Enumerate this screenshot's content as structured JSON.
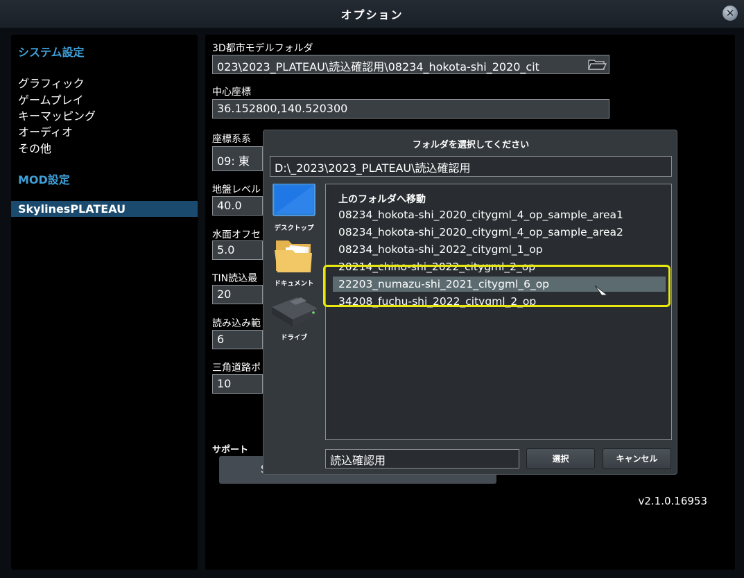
{
  "window": {
    "title": "オプション",
    "close_icon": "close-icon"
  },
  "sidebar": {
    "system_heading": "システム設定",
    "items": [
      "グラフィック",
      "ゲームプレイ",
      "キーマッピング",
      "オーディオ",
      "その他"
    ],
    "mod_heading": "MOD設定",
    "mod_items": [
      "SkylinesPLATEAU"
    ]
  },
  "main": {
    "fields": [
      {
        "label": "3D都市モデルフォルダ",
        "value": "023\\2023_PLATEAU\\読込確認用\\08234_hokota-shi_2020_cit"
      },
      {
        "label": "中心座標",
        "value": "36.152800,140.520300"
      },
      {
        "label": "座標系系",
        "value": "09: 東"
      },
      {
        "label": "地盤レベル",
        "value": "40.0"
      },
      {
        "label": "水面オフセ",
        "value": "5.0"
      },
      {
        "label": "TIN読込最",
        "value": "20"
      },
      {
        "label": "読み込み範",
        "value": "6"
      },
      {
        "label": "三角道路ポ",
        "value": "10"
      }
    ],
    "support_label": "サポート",
    "support_button": "S",
    "version": "v2.1.0.16953"
  },
  "dialog": {
    "title": "フォルダを選択してください",
    "path": "D:\\_2023\\2023_PLATEAU\\読込確認用",
    "places": [
      {
        "label": "デスクトップ",
        "icon": "desktop-icon"
      },
      {
        "label": "ドキュメント",
        "icon": "folder-icon"
      },
      {
        "label": "ドライブ",
        "icon": "drive-icon"
      }
    ],
    "up_label": "上のフォルダへ移動",
    "folders": [
      "08234_hokota-shi_2020_citygml_4_op_sample_area1",
      "08234_hokota-shi_2020_citygml_4_op_sample_area2",
      "08234_hokota-shi_2022_citygml_1_op",
      "20214_chino-shi_2022_citygml_2_op",
      "22203_numazu-shi_2021_citygml_6_op",
      "34208_fuchu-shi_2022_citygml_2_op"
    ],
    "selected_index": 4,
    "name_value": "読込確認用",
    "select_button": "選択",
    "cancel_button": "キャンセル"
  },
  "colors": {
    "accent": "#3fa0d8",
    "selected_row": "#5b6b70",
    "highlight": "#e8e810"
  }
}
